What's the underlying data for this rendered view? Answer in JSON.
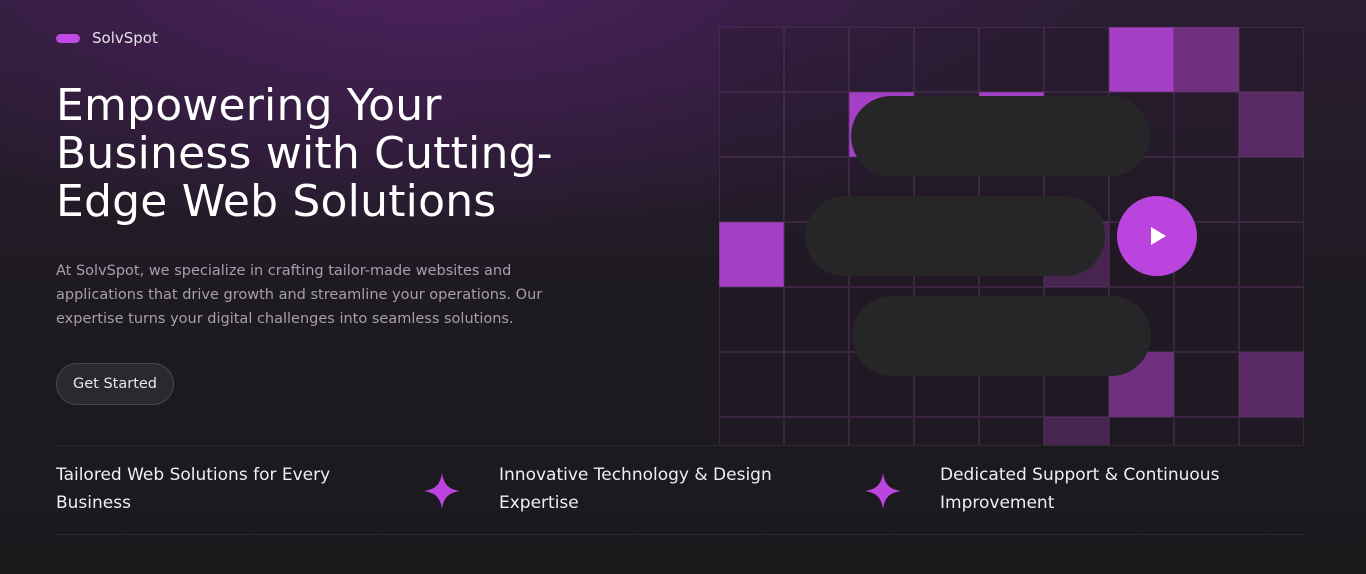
{
  "brand": {
    "name": "SolvSpot",
    "accent": "#c14ae6"
  },
  "hero": {
    "title": "Empowering Your Business with Cutting-Edge Web Solutions",
    "description": "At SolvSpot, we specialize in crafting tailor-made websites and applications that drive growth and streamline your operations. Our expertise turns your digital challenges into seamless solutions.",
    "cta_label": "Get Started"
  },
  "visual": {
    "play_icon": "play-icon",
    "play_color": "#bb44df"
  },
  "features": [
    {
      "text": "Tailored Web Solutions for Every Business"
    },
    {
      "text": "Innovative Technology & Design Expertise"
    },
    {
      "text": "Dedicated Support & Continuous Improvement"
    }
  ],
  "separator_icon": "sparkle-icon"
}
